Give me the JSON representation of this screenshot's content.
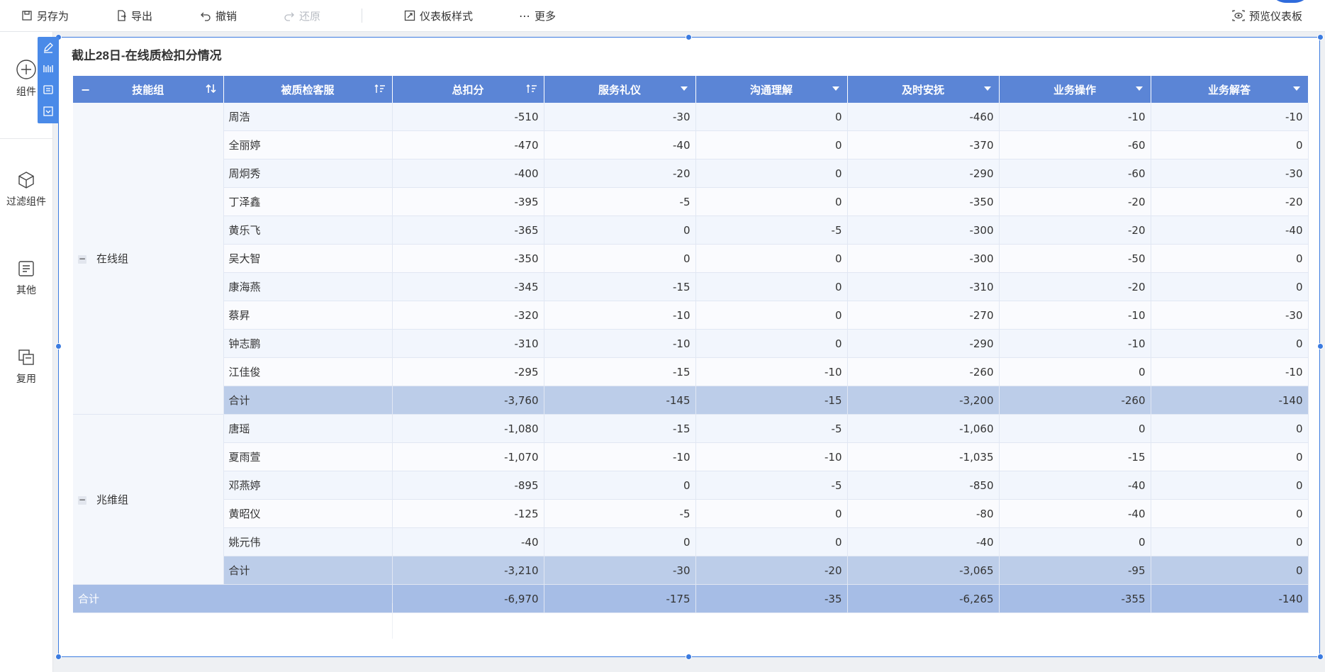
{
  "toolbar": {
    "save_as": "另存为",
    "export": "导出",
    "undo": "撤销",
    "redo": "还原",
    "dashboard_style": "仪表板样式",
    "more": "更多",
    "preview": "预览仪表板"
  },
  "sidebar": {
    "items": [
      {
        "label": "组件",
        "icon": "plus-circle-icon"
      },
      {
        "label": "过滤组件",
        "icon": "cube-icon"
      },
      {
        "label": "其他",
        "icon": "document-icon"
      },
      {
        "label": "复用",
        "icon": "copy-icon"
      }
    ]
  },
  "widget": {
    "title": "截止28日-在线质检扣分情况",
    "columns": [
      {
        "label": "技能组",
        "icon": "sort-icon"
      },
      {
        "label": "被质检客服",
        "icon": "sort-desc-icon"
      },
      {
        "label": "总扣分",
        "icon": "sort-desc-icon"
      },
      {
        "label": "服务礼仪",
        "icon": "dropdown-icon"
      },
      {
        "label": "沟通理解",
        "icon": "dropdown-icon"
      },
      {
        "label": "及时安抚",
        "icon": "dropdown-icon"
      },
      {
        "label": "业务操作",
        "icon": "dropdown-icon"
      },
      {
        "label": "业务解答",
        "icon": "dropdown-icon"
      }
    ],
    "groups": [
      {
        "name": "在线组",
        "rows": [
          [
            "周浩",
            "-510",
            "-30",
            "0",
            "-460",
            "-10",
            "-10"
          ],
          [
            "全丽婷",
            "-470",
            "-40",
            "0",
            "-370",
            "-60",
            "0"
          ],
          [
            "周炯秀",
            "-400",
            "-20",
            "0",
            "-290",
            "-60",
            "-30"
          ],
          [
            "丁泽鑫",
            "-395",
            "-5",
            "0",
            "-350",
            "-20",
            "-20"
          ],
          [
            "黄乐飞",
            "-365",
            "0",
            "-5",
            "-300",
            "-20",
            "-40"
          ],
          [
            "吴大智",
            "-350",
            "0",
            "0",
            "-300",
            "-50",
            "0"
          ],
          [
            "康海燕",
            "-345",
            "-15",
            "0",
            "-310",
            "-20",
            "0"
          ],
          [
            "蔡昇",
            "-320",
            "-10",
            "0",
            "-270",
            "-10",
            "-30"
          ],
          [
            "钟志鹏",
            "-310",
            "-10",
            "0",
            "-290",
            "-10",
            "0"
          ],
          [
            "江佳俊",
            "-295",
            "-15",
            "-10",
            "-260",
            "0",
            "-10"
          ]
        ],
        "subtotal": [
          "合计",
          "-3,760",
          "-145",
          "-15",
          "-3,200",
          "-260",
          "-140"
        ]
      },
      {
        "name": "兆维组",
        "rows": [
          [
            "唐瑶",
            "-1,080",
            "-15",
            "-5",
            "-1,060",
            "0",
            "0"
          ],
          [
            "夏雨萱",
            "-1,070",
            "-10",
            "-10",
            "-1,035",
            "-15",
            "0"
          ],
          [
            "邓燕婷",
            "-895",
            "0",
            "-5",
            "-850",
            "-40",
            "0"
          ],
          [
            "黄昭仪",
            "-125",
            "-5",
            "0",
            "-80",
            "-40",
            "0"
          ],
          [
            "姚元伟",
            "-40",
            "0",
            "0",
            "-40",
            "0",
            "0"
          ]
        ],
        "subtotal": [
          "合计",
          "-3,210",
          "-30",
          "-20",
          "-3,065",
          "-95",
          "0"
        ]
      }
    ],
    "grand_total": [
      "合计",
      "-6,970",
      "-175",
      "-35",
      "-6,265",
      "-355",
      "-140"
    ]
  },
  "colors": {
    "header_bg": "#5b85d6",
    "subtotal_bg": "#bccde9",
    "total_bg": "#a6bde6",
    "accent": "#3b7be0"
  }
}
